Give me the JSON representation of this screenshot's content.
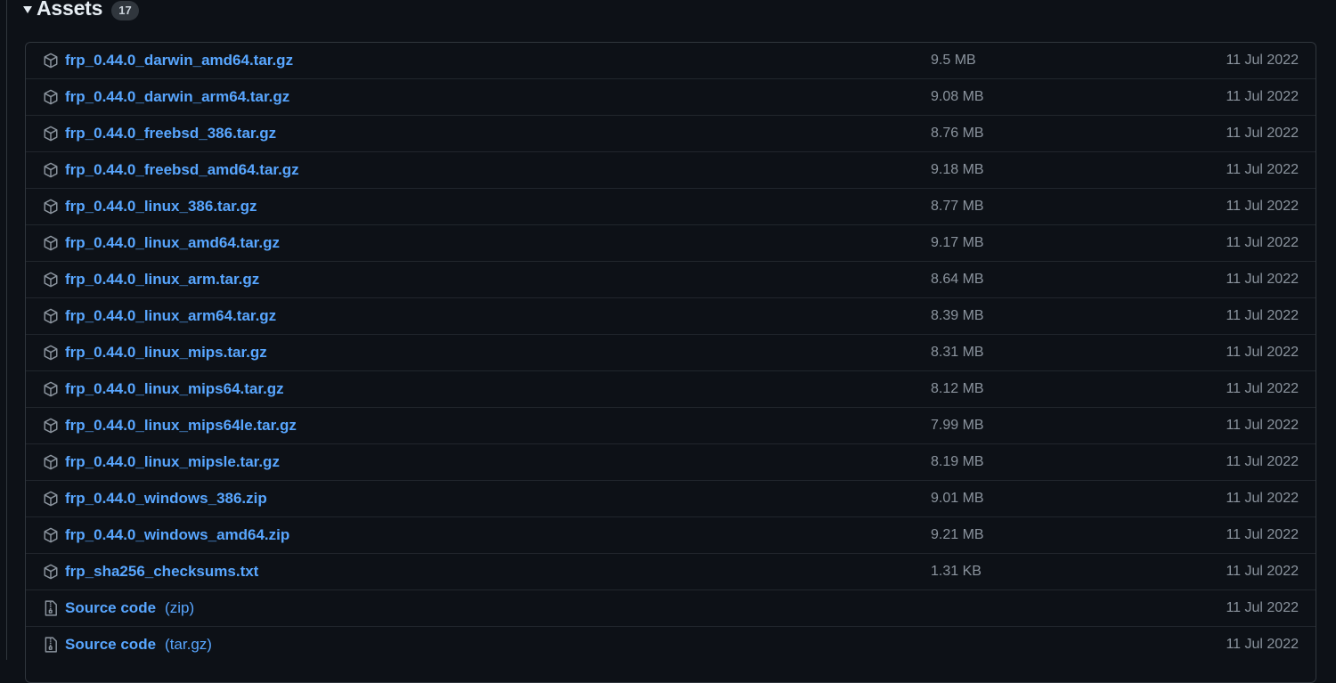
{
  "assets": {
    "title": "Assets",
    "count": "17",
    "items": [
      {
        "name": "frp_0.44.0_darwin_amd64.tar.gz",
        "suffix": "",
        "size": "9.5 MB",
        "date": "11 Jul 2022",
        "icon": "package-icon"
      },
      {
        "name": "frp_0.44.0_darwin_arm64.tar.gz",
        "suffix": "",
        "size": "9.08 MB",
        "date": "11 Jul 2022",
        "icon": "package-icon"
      },
      {
        "name": "frp_0.44.0_freebsd_386.tar.gz",
        "suffix": "",
        "size": "8.76 MB",
        "date": "11 Jul 2022",
        "icon": "package-icon"
      },
      {
        "name": "frp_0.44.0_freebsd_amd64.tar.gz",
        "suffix": "",
        "size": "9.18 MB",
        "date": "11 Jul 2022",
        "icon": "package-icon"
      },
      {
        "name": "frp_0.44.0_linux_386.tar.gz",
        "suffix": "",
        "size": "8.77 MB",
        "date": "11 Jul 2022",
        "icon": "package-icon"
      },
      {
        "name": "frp_0.44.0_linux_amd64.tar.gz",
        "suffix": "",
        "size": "9.17 MB",
        "date": "11 Jul 2022",
        "icon": "package-icon"
      },
      {
        "name": "frp_0.44.0_linux_arm.tar.gz",
        "suffix": "",
        "size": "8.64 MB",
        "date": "11 Jul 2022",
        "icon": "package-icon"
      },
      {
        "name": "frp_0.44.0_linux_arm64.tar.gz",
        "suffix": "",
        "size": "8.39 MB",
        "date": "11 Jul 2022",
        "icon": "package-icon"
      },
      {
        "name": "frp_0.44.0_linux_mips.tar.gz",
        "suffix": "",
        "size": "8.31 MB",
        "date": "11 Jul 2022",
        "icon": "package-icon"
      },
      {
        "name": "frp_0.44.0_linux_mips64.tar.gz",
        "suffix": "",
        "size": "8.12 MB",
        "date": "11 Jul 2022",
        "icon": "package-icon"
      },
      {
        "name": "frp_0.44.0_linux_mips64le.tar.gz",
        "suffix": "",
        "size": "7.99 MB",
        "date": "11 Jul 2022",
        "icon": "package-icon"
      },
      {
        "name": "frp_0.44.0_linux_mipsle.tar.gz",
        "suffix": "",
        "size": "8.19 MB",
        "date": "11 Jul 2022",
        "icon": "package-icon"
      },
      {
        "name": "frp_0.44.0_windows_386.zip",
        "suffix": "",
        "size": "9.01 MB",
        "date": "11 Jul 2022",
        "icon": "package-icon"
      },
      {
        "name": "frp_0.44.0_windows_amd64.zip",
        "suffix": "",
        "size": "9.21 MB",
        "date": "11 Jul 2022",
        "icon": "package-icon"
      },
      {
        "name": "frp_sha256_checksums.txt",
        "suffix": "",
        "size": "1.31 KB",
        "date": "11 Jul 2022",
        "icon": "package-icon"
      },
      {
        "name": "Source code",
        "suffix": "(zip)",
        "size": "",
        "date": "11 Jul 2022",
        "icon": "file-zip-icon"
      },
      {
        "name": "Source code",
        "suffix": "(tar.gz)",
        "size": "",
        "date": "11 Jul 2022",
        "icon": "file-zip-icon"
      }
    ]
  },
  "colors": {
    "background": "#0d1117",
    "link": "#58a6ff",
    "muted": "#8b949e",
    "border": "#30363d"
  }
}
